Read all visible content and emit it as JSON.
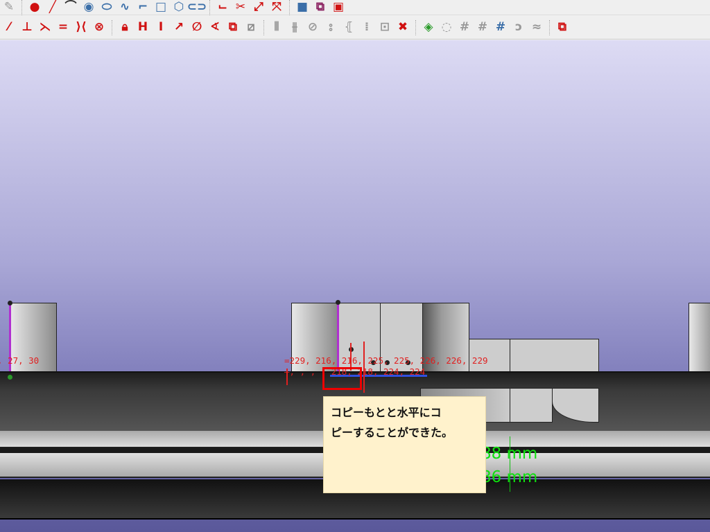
{
  "toolbar_row1": [
    {
      "name": "ruler-icon",
      "glyph": "✎",
      "color": "#999"
    },
    {
      "name": "point-icon",
      "glyph": "●",
      "color": "#d01010"
    },
    {
      "name": "line-icon",
      "glyph": "╱",
      "color": "#d01010"
    },
    {
      "name": "arc-icon",
      "glyph": "⌒",
      "color": "#333"
    },
    {
      "name": "circle-icon",
      "glyph": "◉",
      "color": "#3a6ea8"
    },
    {
      "name": "ellipse-icon",
      "glyph": "⬭",
      "color": "#3a6ea8"
    },
    {
      "name": "bspline-icon",
      "glyph": "∿",
      "color": "#3a6ea8"
    },
    {
      "name": "polyline-icon",
      "glyph": "⌐",
      "color": "#3a6ea8"
    },
    {
      "name": "rectangle-icon",
      "glyph": "□",
      "color": "#3a6ea8"
    },
    {
      "name": "polygon-icon",
      "glyph": "⬡",
      "color": "#3a6ea8"
    },
    {
      "name": "slot-icon",
      "glyph": "⊂⊃",
      "color": "#3a6ea8"
    },
    {
      "name": "fillet-icon",
      "glyph": "⌙",
      "color": "#d01010"
    },
    {
      "name": "trim-icon",
      "glyph": "✂",
      "color": "#d01010"
    },
    {
      "name": "extend-icon",
      "glyph": "⤢",
      "color": "#d01010"
    },
    {
      "name": "split-icon",
      "glyph": "⤧",
      "color": "#d01010"
    },
    {
      "name": "external-geometry-icon",
      "glyph": "■",
      "color": "#3a6ea8"
    },
    {
      "name": "carbon-copy-icon",
      "glyph": "⧉",
      "color": "#8a2060"
    },
    {
      "name": "construction-mode-icon",
      "glyph": "▣",
      "color": "#d01010"
    }
  ],
  "toolbar_row2": [
    {
      "name": "coincident-constraint-icon",
      "glyph": "⁄",
      "color": "#d01010"
    },
    {
      "name": "perpendicular-constraint-icon",
      "glyph": "⊥",
      "color": "#d01010"
    },
    {
      "name": "tangent-constraint-icon",
      "glyph": "⋋",
      "color": "#d01010"
    },
    {
      "name": "equal-constraint-icon",
      "glyph": "=",
      "color": "#d01010"
    },
    {
      "name": "symmetric-constraint-icon",
      "glyph": "⟩⟨",
      "color": "#d01010"
    },
    {
      "name": "block-constraint-icon",
      "glyph": "⊗",
      "color": "#d01010"
    },
    {
      "name": "lock-constraint-icon",
      "glyph": "🔒︎",
      "color": "#d01010"
    },
    {
      "name": "horizontal-distance-icon",
      "glyph": "H",
      "color": "#d01010"
    },
    {
      "name": "vertical-distance-icon",
      "glyph": "I",
      "color": "#d01010"
    },
    {
      "name": "distance-constraint-icon",
      "glyph": "↗",
      "color": "#d01010"
    },
    {
      "name": "radius-constraint-icon",
      "glyph": "∅",
      "color": "#d01010"
    },
    {
      "name": "angle-constraint-icon",
      "glyph": "∢",
      "color": "#d01010"
    },
    {
      "name": "toggle-driving-icon",
      "glyph": "⧉",
      "color": "#d01010"
    },
    {
      "name": "toggle-active-icon",
      "glyph": "⧄",
      "color": "#888"
    },
    {
      "name": "show-dof-icon",
      "glyph": "⫴",
      "color": "#999"
    },
    {
      "name": "select-constraints-icon",
      "glyph": "⫵",
      "color": "#999"
    },
    {
      "name": "select-origin-icon",
      "glyph": "⊘",
      "color": "#999"
    },
    {
      "name": "select-redundant-icon",
      "glyph": "⦂",
      "color": "#999"
    },
    {
      "name": "select-conflicting-icon",
      "glyph": "⦃",
      "color": "#999"
    },
    {
      "name": "select-elements-icon",
      "glyph": "⁞",
      "color": "#999"
    },
    {
      "name": "restore-view-icon",
      "glyph": "⊡",
      "color": "#999"
    },
    {
      "name": "delete-constraints-icon",
      "glyph": "✖",
      "color": "#d01010"
    },
    {
      "name": "validate-sketch-icon",
      "glyph": "◈",
      "color": "#2a9a2a"
    },
    {
      "name": "mirror-icon",
      "glyph": "◌",
      "color": "#999"
    },
    {
      "name": "clone-icon",
      "glyph": "#",
      "color": "#999"
    },
    {
      "name": "copy-icon",
      "glyph": "#",
      "color": "#999"
    },
    {
      "name": "array-icon",
      "glyph": "#",
      "color": "#3a6ea8"
    },
    {
      "name": "symmetry-icon",
      "glyph": "ↄ",
      "color": "#999"
    },
    {
      "name": "remove-axes-icon",
      "glyph": "≈",
      "color": "#999"
    },
    {
      "name": "merge-sketch-icon",
      "glyph": "⧉",
      "color": "#d01010"
    }
  ],
  "viewport": {
    "left_label": ", 27, 30",
    "constraint_row1": "=229, 216, 216, 225, 225, 226, 226, 229",
    "constraint_row2": "–, , , , 218, 218, 224, 224",
    "dimension1": "1.88 mm",
    "dimension2": "0.86 mm"
  },
  "note": {
    "line1": "コピーもとと水平にコ",
    "line2": "ピーすることができた。"
  }
}
